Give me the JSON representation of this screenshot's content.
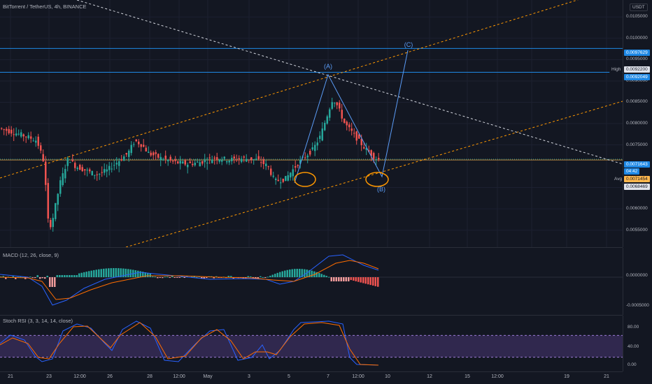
{
  "header": {
    "symbol_title": "BitTorrent / TetherUS, 4h, BINANCE"
  },
  "price_scale": {
    "currency": "USDT",
    "labels": [
      "0.0105000",
      "0.0100000",
      "0.0095000",
      "0.0090000",
      "0.0085000",
      "0.0080000",
      "0.0075000",
      "0.0065000",
      "0.0060000",
      "0.0055000"
    ],
    "label_values": [
      0.0105,
      0.01,
      0.0095,
      0.009,
      0.0085,
      0.008,
      0.0075,
      0.0065,
      0.006,
      0.0055
    ],
    "range": [
      0.0051,
      0.0109
    ]
  },
  "price_tags": {
    "level_c": "0.0097629",
    "high_label": "High",
    "high": "0.0092200",
    "level_a": "0.0092049",
    "last_price": "0.0071643",
    "countdown": "04:42",
    "avg_label": "Avg",
    "avg": "0.0071454",
    "low": "0.0068469"
  },
  "price_levels": {
    "level_c": 0.0097629,
    "level_a": 0.0092049,
    "last": 0.0071643,
    "avg": 0.0071454,
    "low": 0.0068469
  },
  "wave_labels": {
    "a": "(A)",
    "b": "(B)",
    "c": "(C)"
  },
  "macd": {
    "title": "MACD (12, 26, close, 9)",
    "scale_labels": [
      "0.0000000",
      "-0.0005000"
    ]
  },
  "stoch_rsi": {
    "title": "Stoch RSI (3, 3, 14, 14, close)",
    "scale_labels": [
      "80.00",
      "40.00",
      "0.00"
    ],
    "levels": [
      80,
      20
    ]
  },
  "time_axis": {
    "labels": [
      "21",
      "23",
      "12:00",
      "26",
      "28",
      "12:00",
      "May",
      "3",
      "5",
      "7",
      "12:00",
      "10",
      "12",
      "15",
      "12:00",
      "19",
      "21"
    ]
  },
  "colors": {
    "background": "#131722",
    "up": "#26a69a",
    "down": "#ef5350",
    "macd_line": "#2962ff",
    "signal_line": "#ff6d00",
    "stoch_k": "#2962ff",
    "stoch_d": "#ff6d00",
    "rsi_band": "#7e57c2",
    "drawing_blue": "#5b9cf6",
    "drawing_orange": "#ff9800",
    "level_blue": "#1e88e5"
  }
}
